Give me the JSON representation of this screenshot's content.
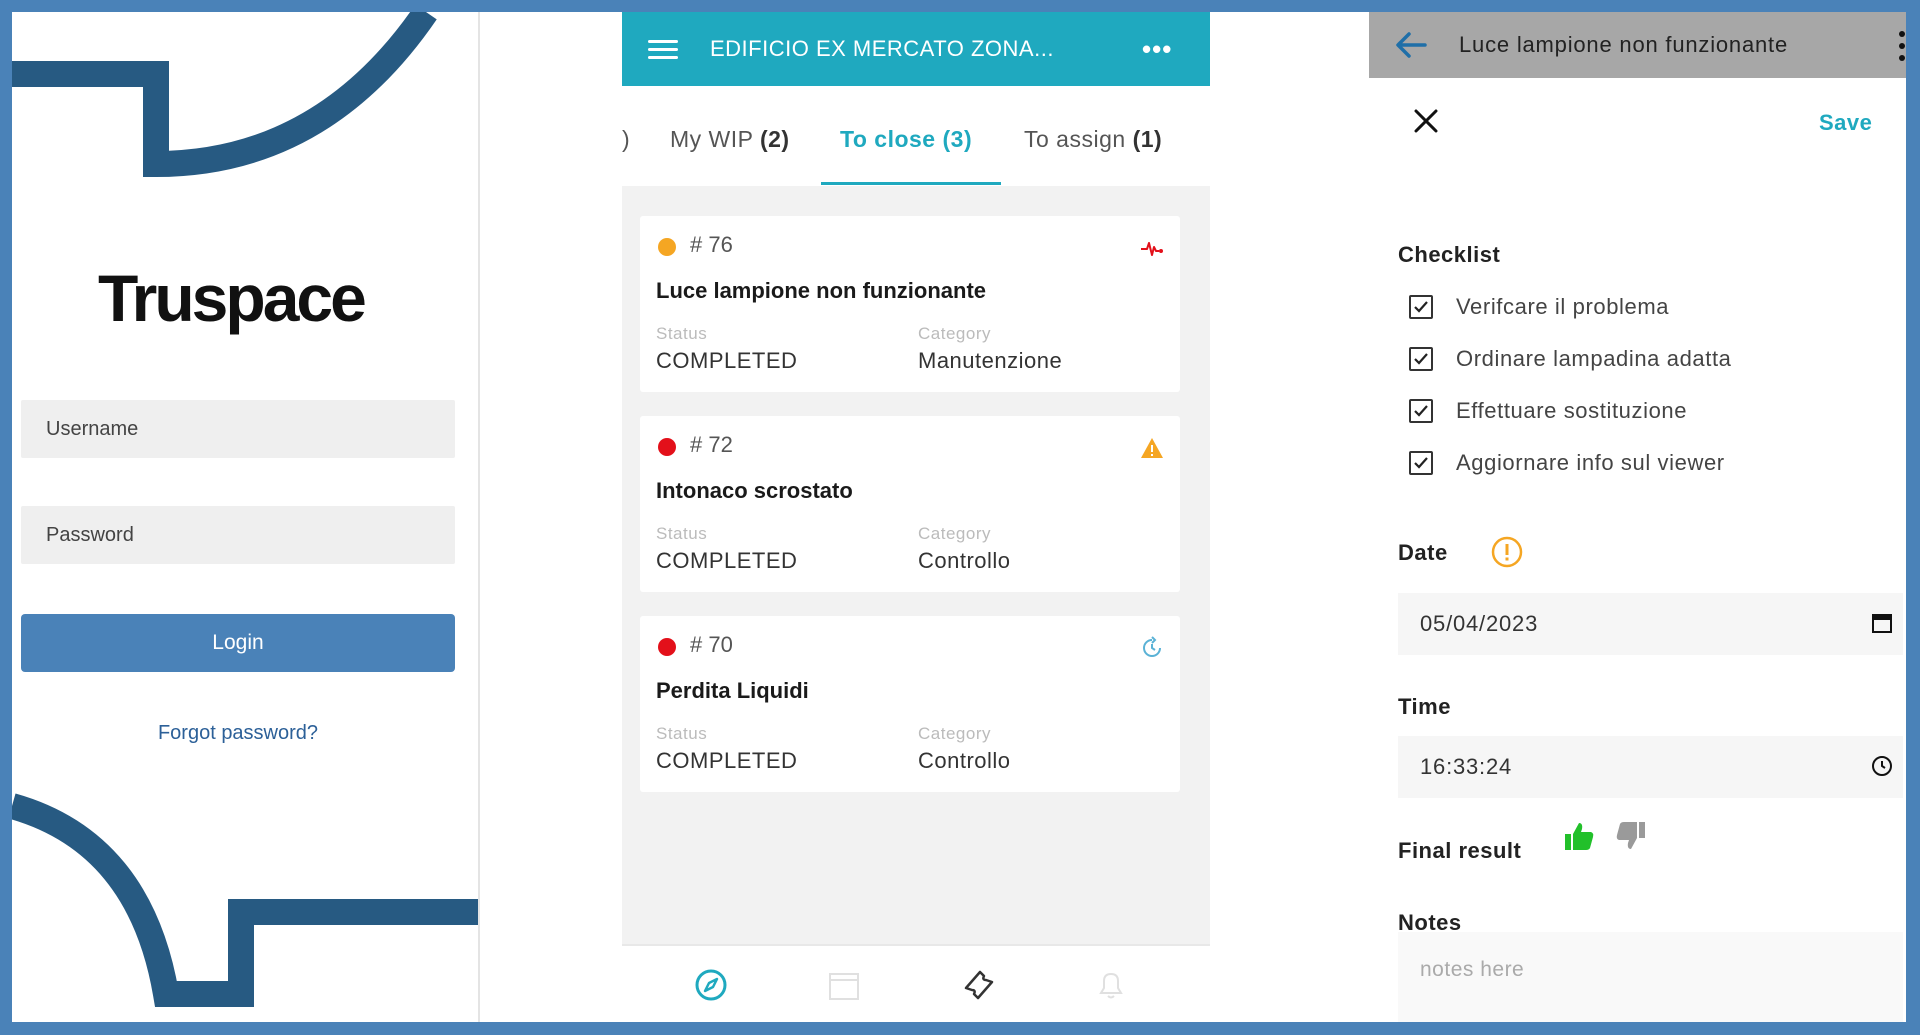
{
  "login": {
    "logo": "Truspace",
    "username_placeholder": "Username",
    "password_placeholder": "Password",
    "login_label": "Login",
    "forgot_label": "Forgot password?"
  },
  "list": {
    "title": "EDIFICIO EX MERCATO ZONA...",
    "more_label": "•••",
    "tabs": [
      {
        "label": "My WIP",
        "count": "(2)",
        "active": false
      },
      {
        "label": "To close",
        "count": "(3)",
        "active": true
      },
      {
        "label": "To assign",
        "count": "(1)",
        "active": false
      }
    ],
    "tab_overflow": ")",
    "status_label": "Status",
    "category_label": "Category",
    "cards": [
      {
        "id": "# 76",
        "dot_color": "#f5a623",
        "title": "Luce lampione non funzionante",
        "status": "COMPLETED",
        "category": "Manutenzione",
        "icon": "pulse-icon"
      },
      {
        "id": "# 72",
        "dot_color": "#e3101a",
        "title": "Intonaco scrostato",
        "status": "COMPLETED",
        "category": "Controllo",
        "icon": "warning-triangle-icon"
      },
      {
        "id": "# 70",
        "dot_color": "#e3101a",
        "title": "Perdita Liquidi",
        "status": "COMPLETED",
        "category": "Controllo",
        "icon": "refresh-clock-icon"
      }
    ],
    "bottom_nav": [
      "compass-icon",
      "calendar-icon",
      "ticket-icon",
      "bell-icon"
    ]
  },
  "detail": {
    "title": "Luce lampione non funzionante",
    "save_label": "Save",
    "checklist_label": "Checklist",
    "checklist": [
      {
        "label": "Verifcare il problema",
        "checked": true
      },
      {
        "label": "Ordinare lampadina adatta",
        "checked": true
      },
      {
        "label": "Effettuare sostituzione",
        "checked": true
      },
      {
        "label": "Aggiornare info sul viewer",
        "checked": true
      }
    ],
    "date_label": "Date",
    "date_value": "05/04/2023",
    "time_label": "Time",
    "time_value": "16:33:24",
    "final_result_label": "Final result",
    "final_result": "thumbs-up",
    "notes_label": "Notes",
    "notes_placeholder": "notes here"
  },
  "colors": {
    "accent": "#1fa9bf",
    "brand_blue": "#4a82b8",
    "deco_navy": "#275a82",
    "thumb_up": "#22c02a",
    "thumb_down": "#9a9a9a",
    "warning": "#f5a623"
  }
}
